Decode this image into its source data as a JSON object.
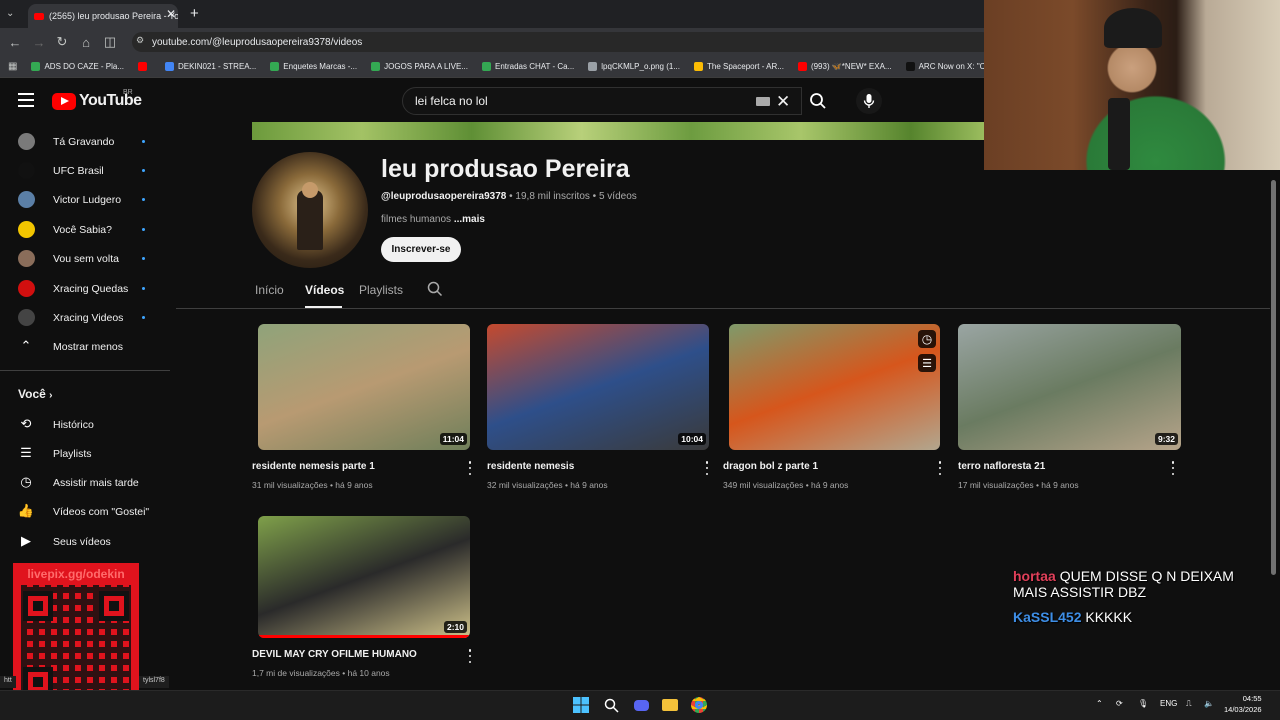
{
  "browser": {
    "tab_title": "(2565) leu produsao Pereira - Yo",
    "url": "youtube.com/@leuprodusaopereira9378/videos",
    "bookmarks": [
      {
        "label": "ADS DO CAZE - Pla...",
        "color": "#34a853"
      },
      {
        "label": "",
        "color": "#ff0000"
      },
      {
        "label": "DEKIN021 - STREA...",
        "color": "#4285f4"
      },
      {
        "label": "Enquetes Marcas -...",
        "color": "#34a853"
      },
      {
        "label": "JOGOS PARA A LIVE...",
        "color": "#34a853"
      },
      {
        "label": "Entradas CHAT - Ca...",
        "color": "#34a853"
      },
      {
        "label": "lpqCKMLP_o.png (1...",
        "color": "#9aa0a6"
      },
      {
        "label": "The Spaceport - AR...",
        "color": "#fbbc04"
      },
      {
        "label": "(993) 🦋*NEW* EXA...",
        "color": "#ff0000"
      },
      {
        "label": "ARC Now on X: \"Co...",
        "color": "#111111"
      }
    ]
  },
  "header": {
    "logo_text": "YouTube",
    "region": "BR",
    "search_query": "lei felca no lol"
  },
  "sidebar": {
    "subscriptions": [
      {
        "label": "Tá Gravando",
        "color": "#7a7a7a"
      },
      {
        "label": "UFC Brasil",
        "color": "#111111"
      },
      {
        "label": "Victor Ludgero",
        "color": "#5b7fa6"
      },
      {
        "label": "Você Sabia?",
        "color": "#f2c500"
      },
      {
        "label": "Vou sem volta",
        "color": "#8a6d5a"
      },
      {
        "label": "Xracing Quedas",
        "color": "#d10f0f"
      },
      {
        "label": "Xracing Videos",
        "color": "#444444"
      }
    ],
    "show_less": "Mostrar menos",
    "you_heading": "Você",
    "you_items": [
      "Histórico",
      "Playlists",
      "Assistir mais tarde",
      "Vídeos com \"Gostei\"",
      "Seus vídeos"
    ]
  },
  "channel": {
    "name": "leu produsao Pereira",
    "handle": "@leuprodusaopereira9378",
    "subs": "19,8 mil inscritos",
    "videos_count": "5 vídeos",
    "description": "filmes humanos",
    "more": "...mais",
    "subscribe_label": "Inscrever-se",
    "tabs": [
      "Início",
      "Vídeos",
      "Playlists"
    ]
  },
  "videos": [
    {
      "title": "residente nemesis parte 1",
      "views": "31 mil visualizações",
      "age": "há 9 anos",
      "duration": "11:04",
      "colors": [
        "#8fa37a",
        "#b89a72",
        "#6f7f5a"
      ]
    },
    {
      "title": "residente nemesis",
      "views": "32 mil visualizações",
      "age": "há 9 anos",
      "duration": "10:04",
      "colors": [
        "#c54a2e",
        "#2e4f8a",
        "#3a3a3a"
      ]
    },
    {
      "title": "dragon bol z parte 1",
      "views": "349 mil visualizações",
      "age": "há 9 anos",
      "duration": "",
      "colors": [
        "#7f9a6a",
        "#d6561c",
        "#b2a68e"
      ]
    },
    {
      "title": "terro nafloresta 21",
      "views": "17 mil visualizações",
      "age": "há 9 anos",
      "duration": "9:32",
      "colors": [
        "#9aa5a3",
        "#6a7b61",
        "#b6a48a"
      ]
    },
    {
      "title": "DEVIL MAY CRY OFILME HUMANO",
      "views": "1,7 mi de visualizações",
      "age": "há 10 anos",
      "duration": "2:10",
      "colors": [
        "#7fa04a",
        "#2a2a2a",
        "#cfc28a"
      ]
    }
  ],
  "overlays": {
    "qr_text": "livepix.gg/odekin",
    "status_url": "htt",
    "status_url_end": "tylsl7f8",
    "chat": [
      {
        "user": "hortaa",
        "user_color": "#e0405a",
        "message": "QUEM DISSE Q N DEIXAM MAIS ASSISTIR DBZ"
      },
      {
        "user": "KaSSL452",
        "user_color": "#3e8ee6",
        "message": "KKKKK"
      }
    ]
  },
  "taskbar": {
    "lang": "ENG",
    "time": "04:55",
    "date": "14/03/2026"
  }
}
